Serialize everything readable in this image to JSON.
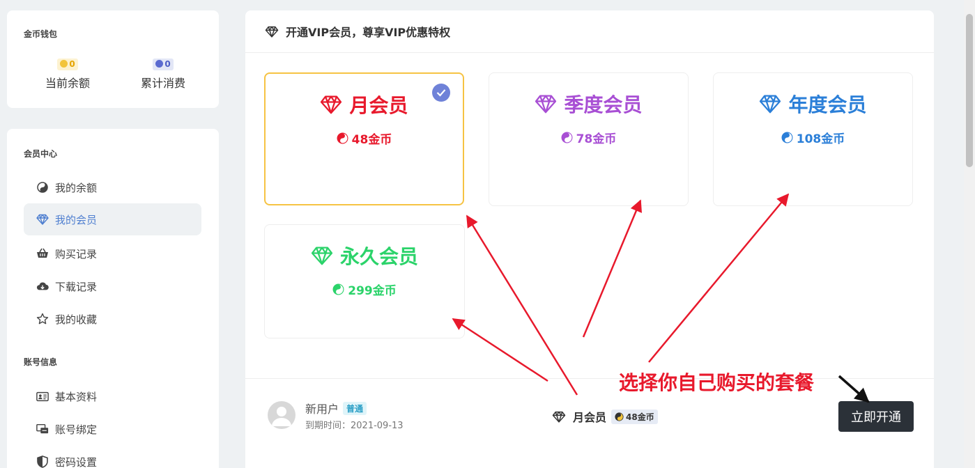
{
  "wallet": {
    "title": "金币钱包",
    "balance_value": "0",
    "balance_label": "当前余额",
    "spent_value": "0",
    "spent_label": "累计消费"
  },
  "nav": {
    "section_member": "会员中心",
    "section_account": "账号信息",
    "items": [
      {
        "label": "我的余额",
        "icon": "yin-yang-icon"
      },
      {
        "label": "我的会员",
        "icon": "diamond-icon",
        "active": true
      },
      {
        "label": "购买记录",
        "icon": "basket-icon"
      },
      {
        "label": "下载记录",
        "icon": "cloud-download-icon"
      },
      {
        "label": "我的收藏",
        "icon": "star-icon"
      },
      {
        "label": "基本资料",
        "icon": "id-card-icon"
      },
      {
        "label": "账号绑定",
        "icon": "link-icon"
      },
      {
        "label": "密码设置",
        "icon": "shield-icon"
      }
    ]
  },
  "main": {
    "heading": "开通VIP会员，尊享VIP优惠特权",
    "plans": [
      {
        "name": "月会员",
        "price": "48金币",
        "color": "#e8192c",
        "selected": true
      },
      {
        "name": "季度会员",
        "price": "78金币",
        "color": "#a84fd4"
      },
      {
        "name": "年度会员",
        "price": "108金币",
        "color": "#2b7fd8"
      },
      {
        "name": "永久会员",
        "price": "299金币",
        "color": "#2bd36a"
      }
    ],
    "user": {
      "name": "新用户",
      "level": "普通",
      "expire": "到期时间：2021-09-13"
    },
    "selected_plan": {
      "name": "月会员",
      "price": "48金币"
    },
    "buy_button": "立即开通",
    "annotation": "选择你自己购买的套餐"
  },
  "colors": {
    "accent": "#4f7fd0",
    "selected_border": "#f6c343",
    "annotation": "#e8192c",
    "button_bg": "#2b3138"
  }
}
